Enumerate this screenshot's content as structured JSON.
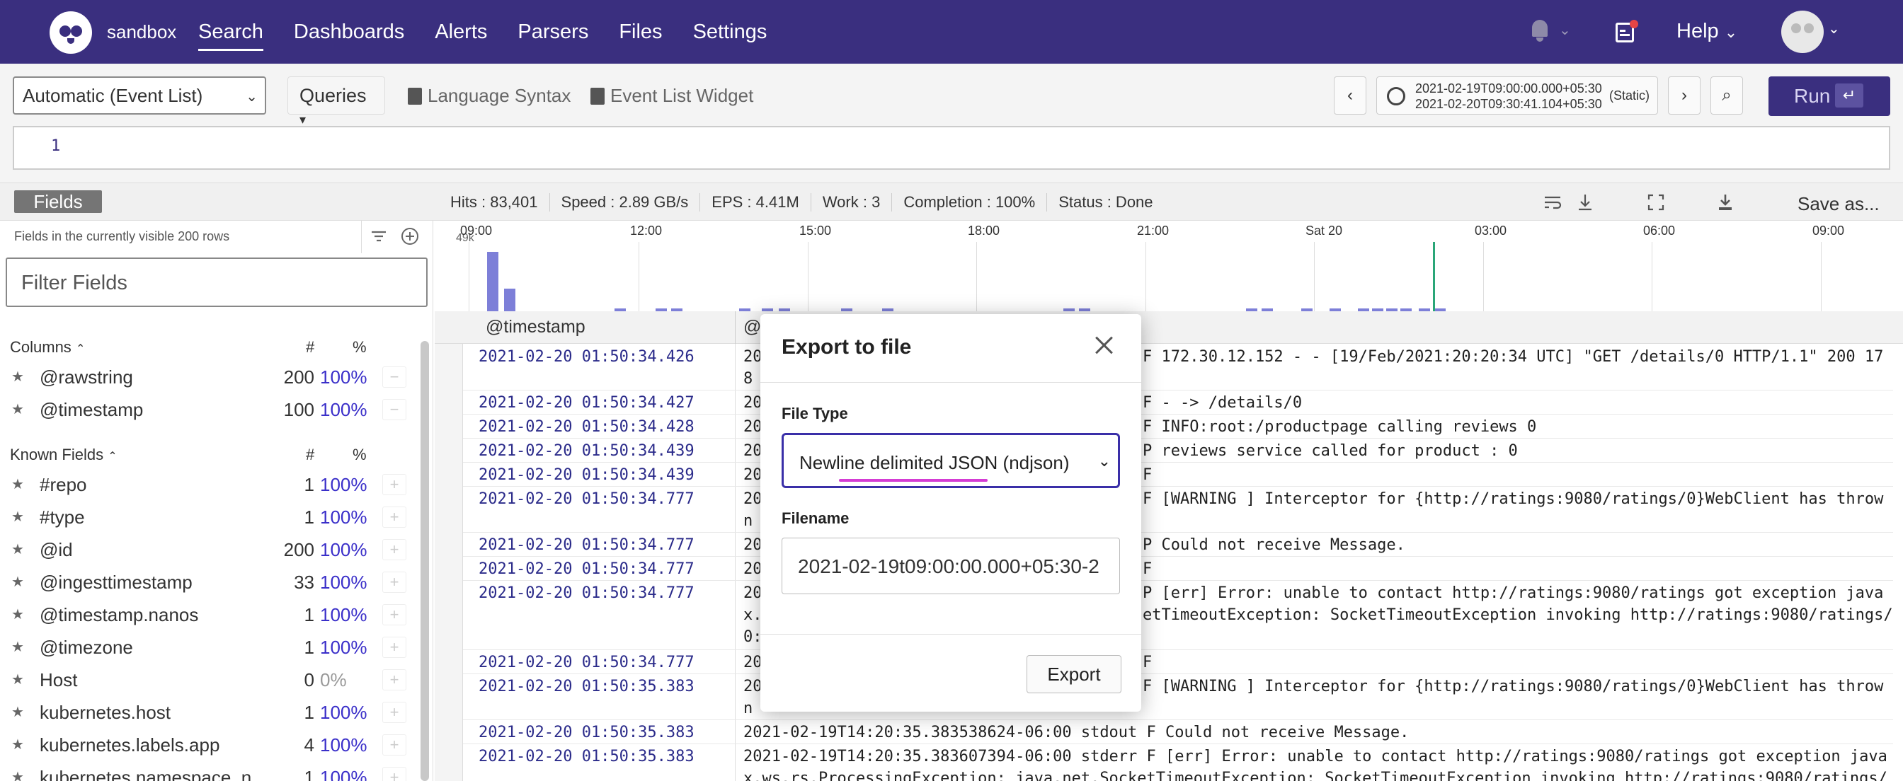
{
  "nav": {
    "org": "sandbox",
    "items": [
      "Search",
      "Dashboards",
      "Alerts",
      "Parsers",
      "Files",
      "Settings"
    ],
    "help": "Help"
  },
  "query": {
    "mode": "Automatic (Event List)",
    "queries_label": "Queries",
    "language_syntax": "Language Syntax",
    "event_list_widget": "Event List Widget",
    "time_start": "2021-02-19T09:00:00.000+05:30",
    "time_end": "2021-02-20T09:30:41.104+05:30",
    "time_mode": "(Static)",
    "run_label": "Run",
    "line_number": "1"
  },
  "status": {
    "fields_tab": "Fields",
    "hits": "Hits : 83,401",
    "speed": "Speed : 2.89 GB/s",
    "eps": "EPS : 4.41M",
    "work": "Work : 3",
    "completion": "Completion : 100%",
    "state": "Status : Done",
    "save_as": "Save as..."
  },
  "sidebar": {
    "note": "Fields in the currently visible 200 rows",
    "filter_placeholder": "Filter Fields",
    "columns_head": "Columns",
    "known_head": "Known Fields",
    "hash": "#",
    "pct": "%",
    "columns": [
      {
        "name": "@rawstring",
        "count": "200",
        "pct": "100%"
      },
      {
        "name": "@timestamp",
        "count": "100",
        "pct": "100%"
      }
    ],
    "known": [
      {
        "name": "#repo",
        "count": "1",
        "pct": "100%"
      },
      {
        "name": "#type",
        "count": "1",
        "pct": "100%"
      },
      {
        "name": "@id",
        "count": "200",
        "pct": "100%"
      },
      {
        "name": "@ingesttimestamp",
        "count": "33",
        "pct": "100%"
      },
      {
        "name": "@timestamp.nanos",
        "count": "1",
        "pct": "100%"
      },
      {
        "name": "@timezone",
        "count": "1",
        "pct": "100%"
      },
      {
        "name": "Host",
        "count": "0",
        "pct": "0%"
      },
      {
        "name": "kubernetes.host",
        "count": "1",
        "pct": "100%"
      },
      {
        "name": "kubernetes.labels.app",
        "count": "4",
        "pct": "100%"
      },
      {
        "name": "kubernetes.namespace_n",
        "count": "1",
        "pct": "100%"
      }
    ]
  },
  "histogram": {
    "ymax_label": "49k",
    "x_labels": [
      "09:00",
      "12:00",
      "15:00",
      "18:00",
      "21:00",
      "Sat 20",
      "03:00",
      "06:00",
      "09:00"
    ]
  },
  "table": {
    "col_timestamp": "@timestamp",
    "col_raw": "@",
    "rows": [
      {
        "ts": "2021-02-20 01:50:34.426",
        "l1": "20",
        "tail1": "F 172.30.12.152 - - [19/Feb/2021:20:20:34 UTC] \"GET /details/0 HTTP/1.1\" 200 17",
        "l2": "8"
      },
      {
        "ts": "2021-02-20 01:50:34.427",
        "l1": "20",
        "tail1": "F - -> /details/0"
      },
      {
        "ts": "2021-02-20 01:50:34.428",
        "l1": "20",
        "tail1": "F INFO:root:/productpage calling reviews 0"
      },
      {
        "ts": "2021-02-20 01:50:34.439",
        "l1": "20",
        "tail1": "P reviews service called for product : 0"
      },
      {
        "ts": "2021-02-20 01:50:34.439",
        "l1": "20",
        "tail1": "F"
      },
      {
        "ts": "2021-02-20 01:50:34.777",
        "l1": "20",
        "tail1": "F [WARNING ] Interceptor for {http://ratings:9080/ratings/0}WebClient has throw",
        "l2": "n"
      },
      {
        "ts": "2021-02-20 01:50:34.777",
        "l1": "20",
        "tail1": "P Could not receive Message."
      },
      {
        "ts": "2021-02-20 01:50:34.777",
        "l1": "20",
        "tail1": "F"
      },
      {
        "ts": "2021-02-20 01:50:34.777",
        "l1": "20",
        "tail1": "P [err] Error: unable to contact http://ratings:9080/ratings got exception java",
        "l2": "x.",
        "tail2": "etTimeoutException: SocketTimeoutException invoking http://ratings:9080/ratings/",
        "l3": "0:"
      },
      {
        "ts": "2021-02-20 01:50:34.777",
        "l1": "20",
        "tail1": "F"
      },
      {
        "ts": "2021-02-20 01:50:35.383",
        "l1": "20",
        "tail1": "F [WARNING ] Interceptor for {http://ratings:9080/ratings/0}WebClient has throw",
        "l2": "n"
      },
      {
        "ts": "2021-02-20 01:50:35.383",
        "l1": "2021-02-19T14:20:35.383538624-06:00 stdout F Could not receive Message."
      },
      {
        "ts": "2021-02-20 01:50:35.383",
        "l1": "2021-02-19T14:20:35.383607394-06:00 stderr F [err] Error: unable to contact http://ratings:9080/ratings got exception java",
        "l2": "x.ws.rs.ProcessingException: java.net.SocketTimeoutException: SocketTimeoutException invoking http://ratings:9080/ratings/"
      }
    ]
  },
  "modal": {
    "title": "Export to file",
    "file_type_label": "File Type",
    "file_type_value": "Newline delimited JSON (ndjson)",
    "filename_label": "Filename",
    "filename_value": "2021-02-19t09:00:00.000+05:30-2",
    "export_label": "Export"
  },
  "colors": {
    "brand": "#3a2f7f",
    "accent": "#3a2fa8",
    "bar": "#7d7fd8"
  }
}
